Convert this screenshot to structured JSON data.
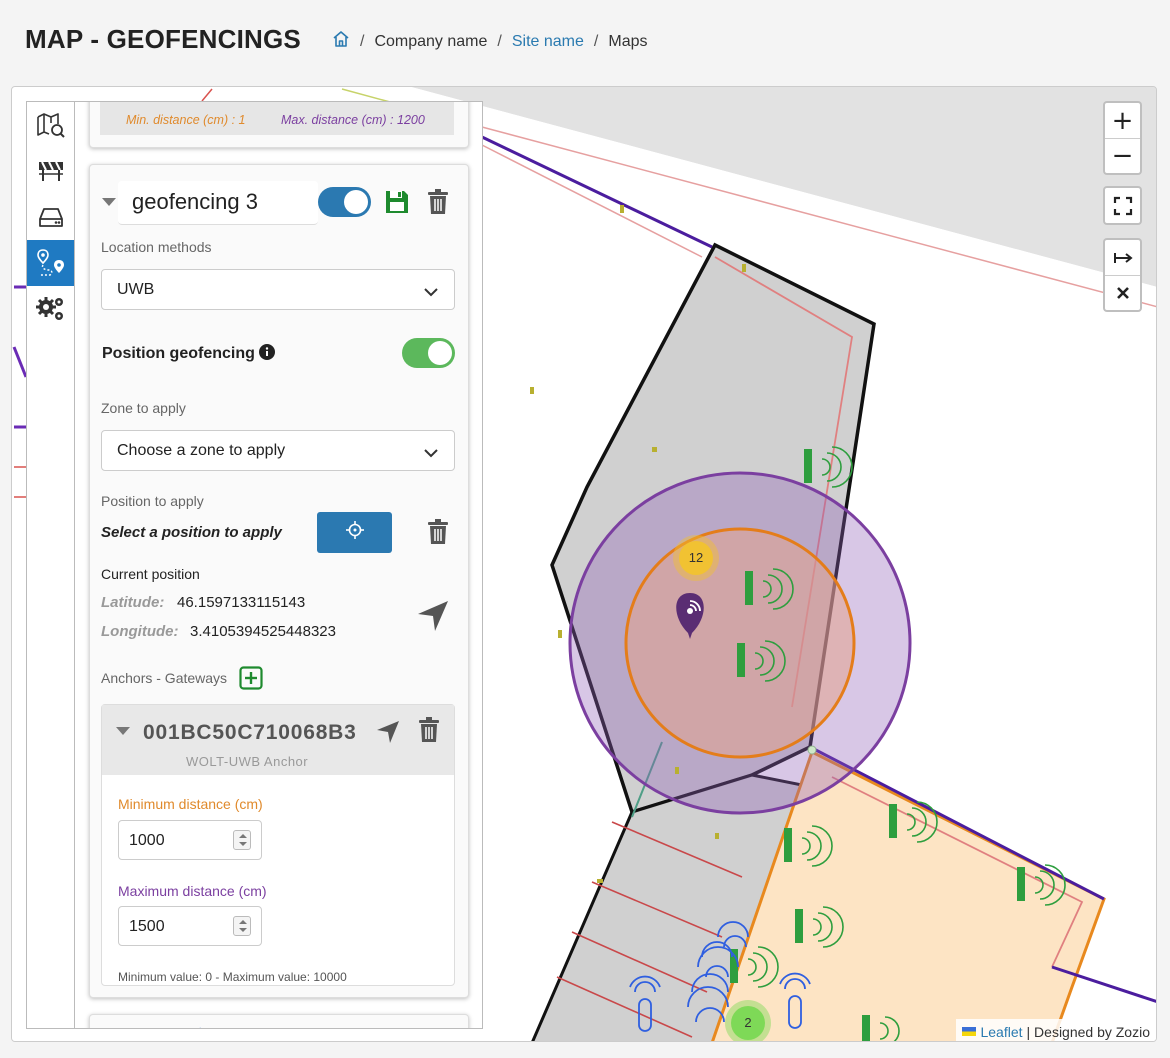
{
  "header": {
    "title": "MAP - GEOFENCINGS",
    "breadcrumb": {
      "company": "Company name",
      "site": "Site name",
      "page": "Maps"
    }
  },
  "previous_card": {
    "min_text": "Min. distance (cm) : 1",
    "max_text": "Max. distance (cm) : 1200"
  },
  "geofencing": {
    "name": "geofencing 3",
    "enabled": true,
    "location_methods_label": "Location methods",
    "location_method": "UWB",
    "position_geofencing_label": "Position geofencing",
    "position_geofencing_enabled": true,
    "zone_label": "Zone to apply",
    "zone_placeholder": "Choose a zone to apply",
    "position_label": "Position to apply",
    "position_select_text": "Select a position to apply",
    "current_position_label": "Current position",
    "latitude_label": "Latitude:",
    "latitude": "46.1597133115143",
    "longitude_label": "Longitude:",
    "longitude": "3.4105394525448323",
    "anchors_label": "Anchors - Gateways"
  },
  "anchor": {
    "id": "001BC50C710068B3",
    "type": "WOLT-UWB Anchor",
    "min_label": "Minimum distance (cm)",
    "min_value": "1000",
    "max_label": "Maximum distance (cm)",
    "max_value": "1500",
    "range_hint": "Minimum value: 0 - Maximum value: 10000"
  },
  "map": {
    "cluster_yellow": "12",
    "cluster_green": "2",
    "attribution_link": "Leaflet",
    "attribution_text": "| Designed by Zozio"
  },
  "colors": {
    "accent_blue": "#1f7ac2",
    "toggle_blue": "#2b79b1",
    "toggle_green": "#5cb85c",
    "min_orange": "#e08a2c",
    "max_purple": "#7b3fa0",
    "save_green": "#1e8a2e"
  },
  "icons": {
    "sidebar": [
      "map-search-icon",
      "roadblock-icon",
      "server-icon",
      "route-pin-icon",
      "gears-icon"
    ],
    "controls": [
      "zoom-in-icon",
      "zoom-out-icon",
      "fullscreen-icon",
      "measure-icon",
      "close-icon"
    ]
  }
}
